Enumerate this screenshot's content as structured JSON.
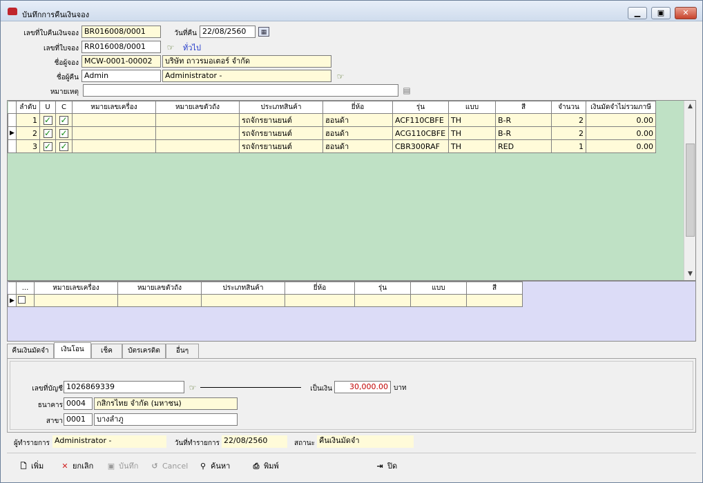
{
  "window": {
    "title": "บันทึกการคืนเงินจอง",
    "min": "▁",
    "max": "▣",
    "close": "✕"
  },
  "header": {
    "receipt_no_label": "เลขที่ใบคืนเงินจอง",
    "receipt_no": "BR016008/0001",
    "return_date_label": "วันที่คืน",
    "return_date": "22/08/2560",
    "booking_no_label": "เลขที่ใบจอง",
    "booking_no": "RR016008/0001",
    "general_link": "ทั่วไป",
    "booker_label": "ชื่อผู้จอง",
    "booker_code": "MCW-0001-00002",
    "booker_name": "บริษัท ถาวรมอเตอร์ จำกัด",
    "returner_label": "ชื่อผู้คืน",
    "returner_code": "Admin",
    "returner_name": "Administrator -",
    "remark_label": "หมายเหตุ",
    "remark": ""
  },
  "grid1": {
    "columns": [
      "ลำดับ",
      "U",
      "C",
      "หมายเลขเครื่อง",
      "หมายเลขตัวถัง",
      "ประเภทสินค้า",
      "ยี่ห้อ",
      "รุ่น",
      "แบบ",
      "สี",
      "จำนวน",
      "เงินมัดจำไม่รวมภาษี"
    ],
    "rows": [
      {
        "seq": "1",
        "u": "✓",
        "c": "✓",
        "engine": "",
        "chassis": "",
        "type": "รถจักรยานยนต์",
        "brand": "ฮอนด้า",
        "model": "ACF110CBFE",
        "style": "TH",
        "color": "B-R",
        "qty": "2",
        "deposit": "0.00"
      },
      {
        "seq": "2",
        "u": "✓",
        "c": "✓",
        "engine": "",
        "chassis": "",
        "type": "รถจักรยานยนต์",
        "brand": "ฮอนด้า",
        "model": "ACG110CBFE",
        "style": "TH",
        "color": "B-R",
        "qty": "2",
        "deposit": "0.00"
      },
      {
        "seq": "3",
        "u": "✓",
        "c": "✓",
        "engine": "",
        "chassis": "",
        "type": "รถจักรยานยนต์",
        "brand": "ฮอนด้า",
        "model": "CBR300RAF",
        "style": "TH",
        "color": "RED",
        "qty": "1",
        "deposit": "0.00"
      }
    ]
  },
  "grid2": {
    "columns": [
      "...",
      "หมายเลขเครื่อง",
      "หมายเลขตัวถัง",
      "ประเภทสินค้า",
      "ยี่ห้อ",
      "รุ่น",
      "แบบ",
      "สี"
    ]
  },
  "tabs": [
    "คืนเงินมัดจำ",
    "เงินโอน",
    "เช็ค",
    "บัตรเครดิต",
    "อื่นๆ"
  ],
  "transfer": {
    "account_label": "เลขที่บัญชี",
    "account_no": "1026869339",
    "amount_label": "เป็นเงิน",
    "amount": "30,000.00",
    "currency": "บาท",
    "bank_label": "ธนาคาร",
    "bank_code": "0004",
    "bank_name": "กสิกรไทย จำกัด (มหาชน)",
    "branch_label": "สาขา",
    "branch_code": "0001",
    "branch_name": "บางลำภู"
  },
  "footer": {
    "operator_label": "ผู้ทำรายการ",
    "operator": "Administrator -",
    "txn_date_label": "วันที่ทำรายการ",
    "txn_date": "22/08/2560",
    "status_label": "สถานะ",
    "status": "คืนเงินมัดจำ"
  },
  "toolbar": {
    "add": "เพิ่ม",
    "cancel_doc": "ยกเลิก",
    "save": "บันทึก",
    "cancel": "Cancel",
    "search": "ค้นหา",
    "print": "พิมพ์",
    "close": "ปิด"
  },
  "colors": {
    "grid1_bg": "#bfe1c5",
    "grid2_bg": "#dcdcf7",
    "field_bg": "#fffbd9",
    "amount": "#c00000"
  }
}
